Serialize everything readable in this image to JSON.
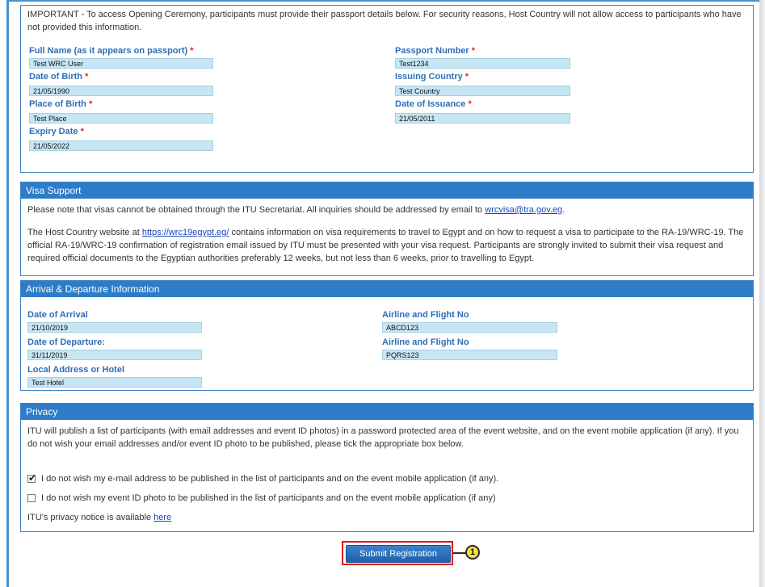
{
  "passport": {
    "notice": "IMPORTANT - To access Opening Ceremony, participants must provide their passport details below. For security reasons, Host Country will not allow access to participants who have not provided this information.",
    "fields": {
      "full_name": {
        "label": "Full Name (as it appears on passport)",
        "value": "Test WRC User"
      },
      "passport_number": {
        "label": "Passport Number",
        "value": "Test1234"
      },
      "dob": {
        "label": "Date of Birth",
        "value": "21/05/1990"
      },
      "issuing_country": {
        "label": "Issuing Country",
        "value": "Test Country"
      },
      "place_of_birth": {
        "label": "Place of Birth",
        "value": "Test Place"
      },
      "date_of_issuance": {
        "label": "Date of Issuance",
        "value": "21/05/2011"
      },
      "expiry_date": {
        "label": "Expiry Date",
        "value": "21/05/2022"
      }
    },
    "required_mark": "*"
  },
  "visa": {
    "title": "Visa Support",
    "para1_pre": "Please note that visas cannot be obtained through the ITU Secretariat. All inquiries should be addressed by email to ",
    "para1_link": "wrcvisa@tra.gov.eg",
    "para1_post": ".",
    "para2_pre": "The Host Country website at ",
    "para2_link": "https://wrc19egypt.eg/",
    "para2_post": " contains information on visa requirements to travel to Egypt and on how to request a visa to participate to the RA-19/WRC-19. The official RA-19/WRC-19 confirmation of registration email issued by ITU must be presented with your visa request. Participants are strongly invited to submit their visa request and required official documents to the Egyptian authorities preferably 12 weeks, but not less than 6 weeks, prior to travelling to Egypt."
  },
  "arrival": {
    "title": "Arrival & Departure Information",
    "date_of_arrival": {
      "label": "Date of Arrival",
      "value": "21/10/2019"
    },
    "airline_arrival": {
      "label": "Airline and Flight No",
      "value": "ABCD123"
    },
    "date_of_departure": {
      "label": "Date of Departure:",
      "value": "31/11/2019"
    },
    "airline_departure": {
      "label": "Airline and Flight No",
      "value": "PQRS123"
    },
    "local_address": {
      "label": "Local Address or Hotel",
      "value": "Test Hotel"
    }
  },
  "privacy": {
    "title": "Privacy",
    "text": "ITU will publish a list of participants (with email addresses and event ID photos) in a password protected area of the event website, and on the event mobile application (if any). If you do not wish your email addresses and/or event ID photo to be published, please tick the appropriate box below.",
    "opt_email": {
      "label": "I do not wish my e-mail address to be published in the list of participants and on the event mobile application (if any).",
      "checked": true
    },
    "opt_photo": {
      "label": "I do not wish my event ID photo to be published in the list of participants and on the event mobile application (if any)",
      "checked": false
    },
    "notice_pre": "ITU's privacy notice is available ",
    "notice_link": "here"
  },
  "submit": {
    "label": "Submit Registration",
    "callout": "1"
  }
}
